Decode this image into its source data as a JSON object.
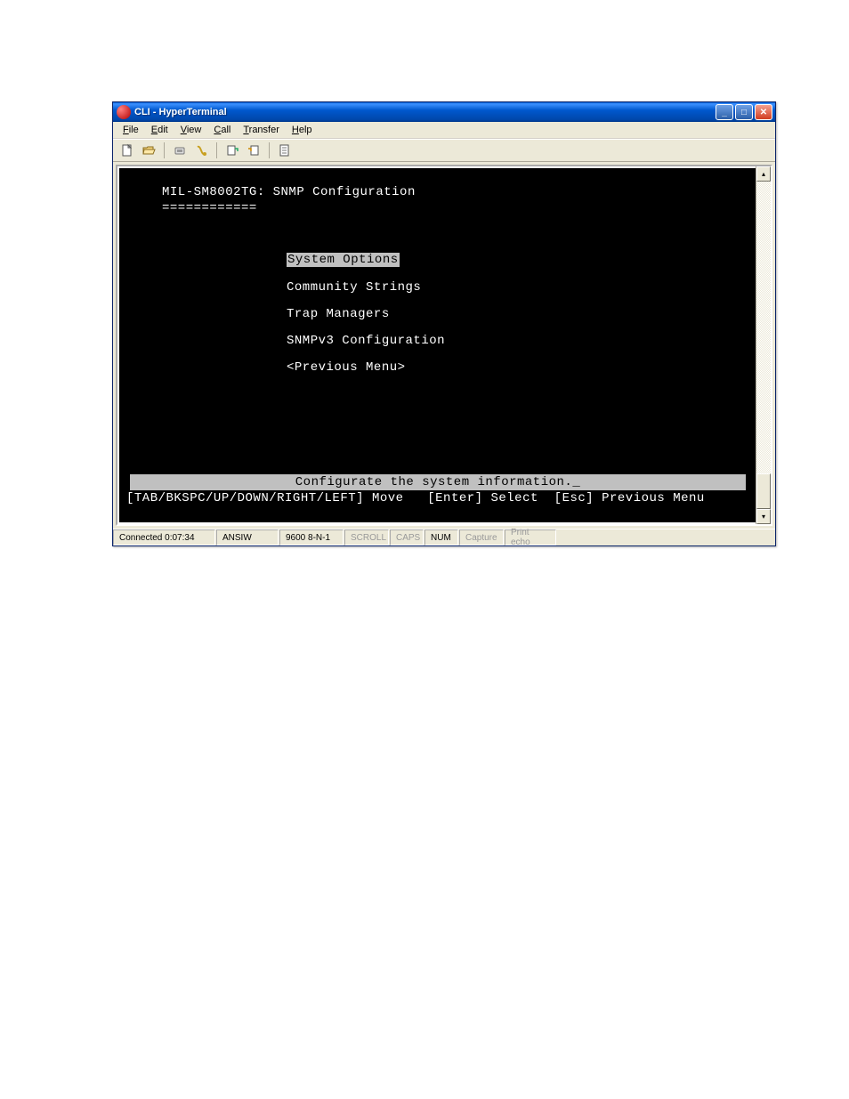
{
  "window": {
    "title": "CLI - HyperTerminal"
  },
  "menubar": {
    "file": "File",
    "edit": "Edit",
    "view": "View",
    "call": "Call",
    "transfer": "Transfer",
    "help": "Help"
  },
  "terminal": {
    "heading": "MIL-SM8002TG: SNMP Configuration",
    "underline": "============",
    "menu": [
      {
        "label": "System Options",
        "selected": true
      },
      {
        "label": "Community Strings",
        "selected": false
      },
      {
        "label": "Trap Managers",
        "selected": false
      },
      {
        "label": "SNMPv3 Configuration",
        "selected": false
      },
      {
        "label": "<Previous Menu>",
        "selected": false
      }
    ],
    "hint": "Configurate the system information._",
    "nav": "[TAB/BKSPC/UP/DOWN/RIGHT/LEFT] Move   [Enter] Select  [Esc] Previous Menu"
  },
  "statusbar": {
    "connected": "Connected 0:07:34",
    "emulation": "ANSIW",
    "port": "9600 8-N-1",
    "scroll": "SCROLL",
    "caps": "CAPS",
    "num": "NUM",
    "capture": "Capture",
    "printecho": "Print echo"
  }
}
